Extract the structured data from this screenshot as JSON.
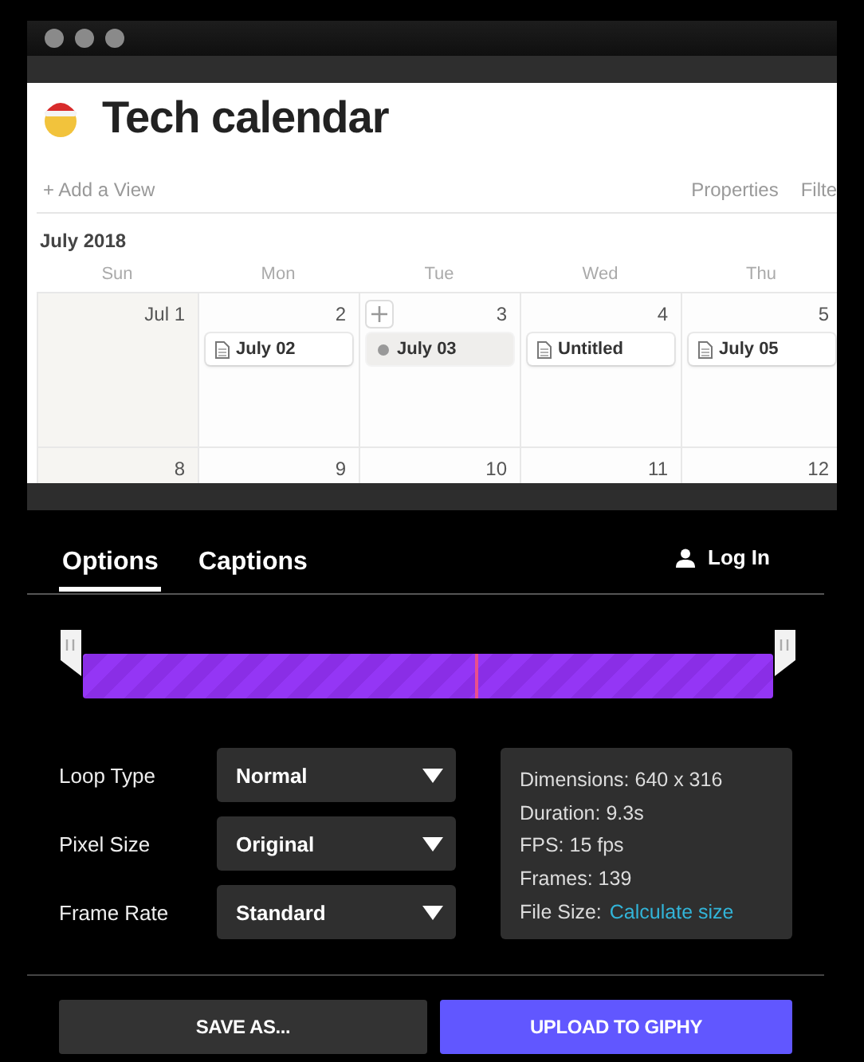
{
  "preview": {
    "title": "Tech calendar",
    "add_view": "+ Add a View",
    "actions": [
      "Properties",
      "Filte"
    ],
    "month": "July 2018",
    "weekdays": [
      "Sun",
      "Mon",
      "Tue",
      "Wed",
      "Thu"
    ],
    "weeks": [
      {
        "days": [
          {
            "label": "Jul 1",
            "weekend": true,
            "add": false
          },
          {
            "label": "2",
            "weekend": false,
            "add": false,
            "events": [
              {
                "title": "July 02",
                "kind": "page"
              }
            ]
          },
          {
            "label": "3",
            "weekend": false,
            "add": true,
            "events": [
              {
                "title": "July 03",
                "kind": "draft"
              }
            ]
          },
          {
            "label": "4",
            "weekend": false,
            "add": false,
            "events": [
              {
                "title": "Untitled",
                "kind": "page"
              }
            ]
          },
          {
            "label": "5",
            "weekend": false,
            "add": false,
            "events": [
              {
                "title": "July 05",
                "kind": "page"
              }
            ]
          }
        ]
      },
      {
        "days": [
          {
            "label": "8",
            "weekend": true,
            "add": false
          },
          {
            "label": "9",
            "weekend": false,
            "add": false
          },
          {
            "label": "10",
            "weekend": false,
            "add": false
          },
          {
            "label": "11",
            "weekend": false,
            "add": false
          },
          {
            "label": "12",
            "weekend": false,
            "add": false
          }
        ]
      }
    ]
  },
  "tabs": [
    {
      "label": "Options",
      "selected": true
    },
    {
      "label": "Captions",
      "selected": false
    }
  ],
  "login": "Log In",
  "timeline": {
    "level": 0.57
  },
  "settings": [
    {
      "label": "Loop Type",
      "value": "Normal"
    },
    {
      "label": "Pixel Size",
      "value": "Original"
    },
    {
      "label": "Frame Rate",
      "value": "Standard"
    }
  ],
  "info": [
    {
      "kind": "text",
      "text": "Dimensions: 640 x 316"
    },
    {
      "kind": "text",
      "text": "Duration: 9.3s"
    },
    {
      "kind": "text",
      "text": "FPS: 15 fps"
    },
    {
      "kind": "text",
      "text": "Frames: 139"
    },
    {
      "kind": "link",
      "text": "File Size:",
      "link": "Calculate size"
    }
  ],
  "buttons": [
    {
      "label": "SAVE AS...",
      "kind": "secondary"
    },
    {
      "label": "UPLOAD TO GIPHY",
      "kind": "primary"
    }
  ]
}
